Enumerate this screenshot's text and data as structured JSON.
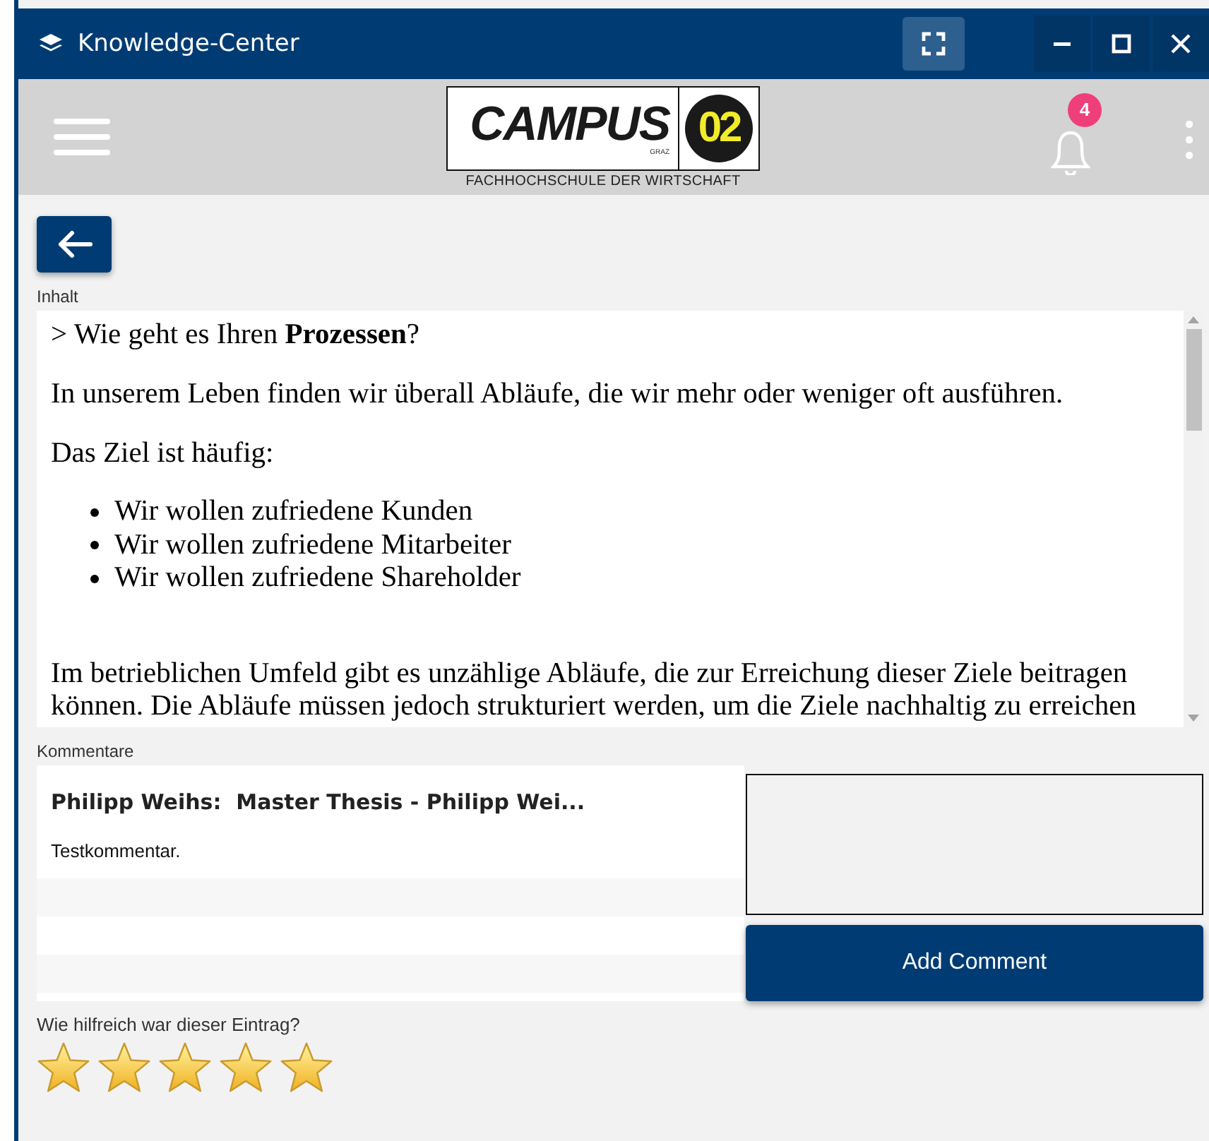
{
  "window": {
    "title": "Knowledge-Center"
  },
  "header": {
    "logo": {
      "name": "CAMPUS",
      "number": "02",
      "city": "GRAZ",
      "tagline": "FACHHOCHSCHULE DER WIRTSCHAFT"
    },
    "notifications": {
      "count": "4"
    }
  },
  "content": {
    "label": "Inhalt",
    "blocks": [
      {
        "kind": "paragraph",
        "text": "> Wie geht es Ihren **Prozessen**?"
      },
      {
        "kind": "paragraph",
        "text": "In unserem Leben finden wir überall Abläufe, die wir mehr oder weniger oft ausführen."
      },
      {
        "kind": "paragraph",
        "text": "Das Ziel ist häufig:"
      },
      {
        "kind": "list",
        "items": [
          "Wir wollen zufriedene Kunden",
          "Wir wollen zufriedene Mitarbeiter",
          "Wir wollen zufriedene Shareholder"
        ]
      },
      {
        "kind": "paragraph",
        "text": "Im betrieblichen Umfeld gibt es unzählige Abläufe, die zur Erreichung dieser Ziele beitragen können. Die Abläufe müssen jedoch strukturiert werden, um die Ziele nachhaltig zu erreichen"
      }
    ]
  },
  "comments": {
    "label": "Kommentare",
    "items": [
      {
        "title": "Philipp Weihs:  Master Thesis - Philipp Wei...",
        "text": "Testkommentar."
      }
    ],
    "button": "Add Comment"
  },
  "rating": {
    "label": "Wie hilfreich war dieser Eintrag?",
    "stars": 5
  }
}
